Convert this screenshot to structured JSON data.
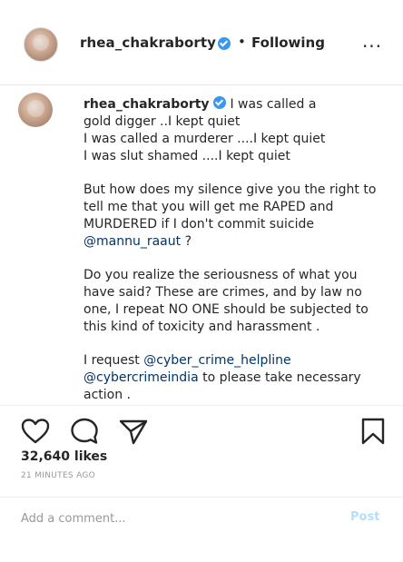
{
  "header": {
    "username": "rhea_chakraborty",
    "separator": "•",
    "follow_status": "Following",
    "more_label": "..."
  },
  "caption": {
    "username": "rhea_chakraborty",
    "line1": "I was called a",
    "line2": "gold digger ..I kept quiet",
    "line3": "I was called a murderer ....I kept quiet",
    "line4": "I was slut shamed ....I kept quiet",
    "para2": "But how does my silence give you the right to tell me that you will get me RAPED and MURDERED if I don't commit suicide",
    "mention1": "@mannu_raaut",
    "para2_end": "?",
    "para3": "Do you realize the seriousness of what you have said? These are crimes, and by law no one, I repeat NO ONE should be subjected to this kind of toxicity and harassment .",
    "para4_start": "I request",
    "mention2": "@cyber_crime_helpline",
    "mention3": "@cybercrimeindia",
    "para4_end": "to please take necessary action ."
  },
  "actions": {
    "like_icon": "heart-icon",
    "comment_icon": "comment-icon",
    "share_icon": "share-icon",
    "save_icon": "bookmark-icon"
  },
  "likes_text": "32,640 likes",
  "timestamp": "21 MINUTES AGO",
  "comment": {
    "placeholder": "Add a comment...",
    "post_label": "Post"
  },
  "colors": {
    "verified_badge": "#3897f0",
    "mention": "#003569",
    "post_disabled": "#b2dffc",
    "muted_text": "#999999"
  }
}
